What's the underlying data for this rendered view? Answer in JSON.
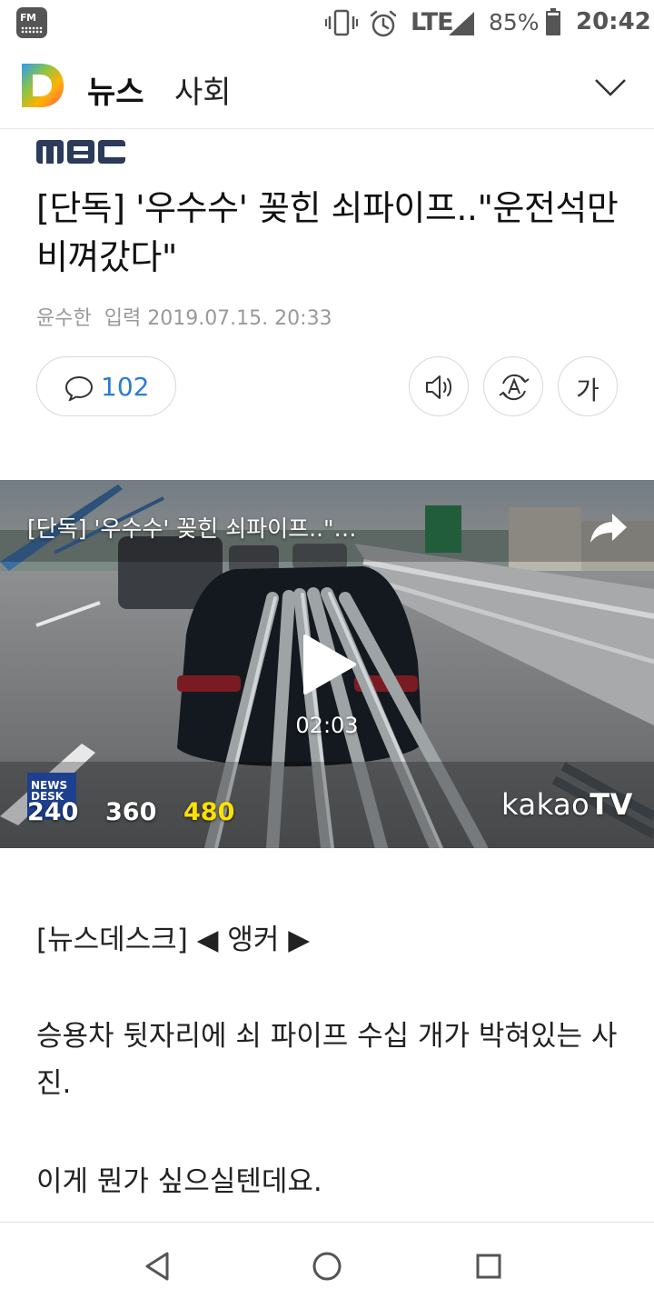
{
  "status_bar": {
    "fm_label": "FM",
    "network": "LTE",
    "battery": "85%",
    "time": "20:42",
    "icons": [
      "fm-radio-icon",
      "vibrate-icon",
      "alarm-icon",
      "signal-icon",
      "battery-icon"
    ]
  },
  "header": {
    "title": "뉴스",
    "section": "사회",
    "logo": "daum-logo",
    "menu_icon": "chevron-down-icon"
  },
  "article": {
    "press": "mbc",
    "headline": "[단독] '우수수' 꽂힌 쇠파이프..\"운전석만 비껴갔다\"",
    "author": "윤수한",
    "published": "입력 2019.07.15. 20:33",
    "comment_count": "102",
    "font_button": "가"
  },
  "video": {
    "title": "[단독] '우수수' 꽂힌 쇠파이프..\"…",
    "duration": "02:03",
    "news_desk_line1": "NEWS",
    "news_desk_line2": "DESK",
    "qualities": [
      "240",
      "360",
      "480"
    ],
    "selected_quality": "480",
    "brand_prefix": "kakao",
    "brand_suffix": "TV",
    "accent_color": "#ffe100"
  },
  "body": {
    "paragraphs": [
      "[뉴스데스크] ◀ 앵커 ▶",
      "승용차 뒷자리에 쇠 파이프 수십 개가 박혀있는 사진.",
      "이게 뭔가 싶으실텐데요."
    ]
  },
  "colors": {
    "accent_blue": "#2a7bd6",
    "text": "#222222",
    "muted": "#999999"
  }
}
